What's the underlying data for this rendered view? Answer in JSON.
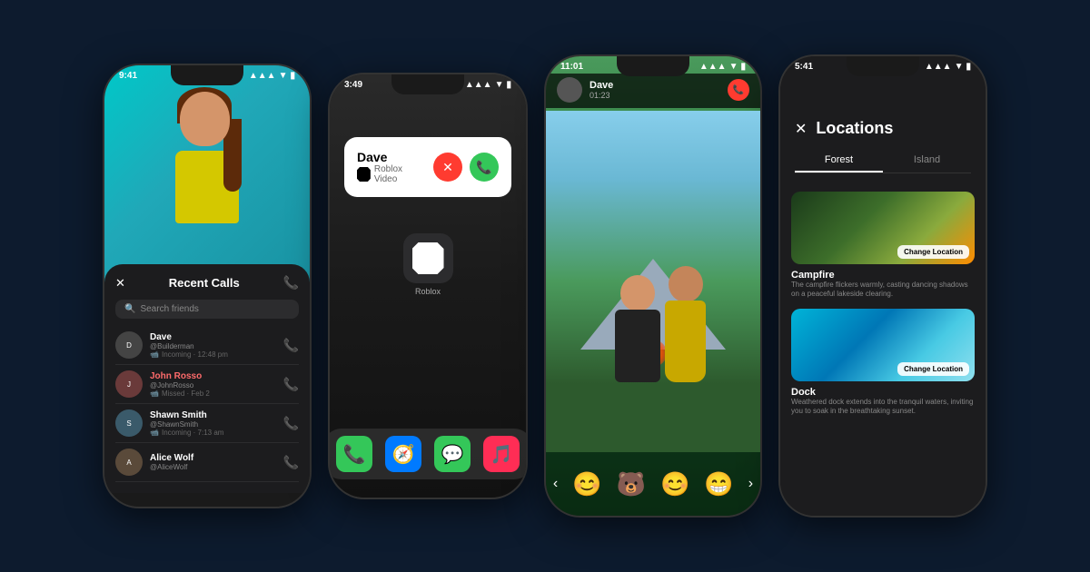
{
  "page": {
    "background": "#0d1b2e"
  },
  "phone1": {
    "status_time": "9:41",
    "panel_title": "Recent Calls",
    "search_placeholder": "Search friends",
    "calls": [
      {
        "name": "Dave",
        "username": "@Builderman",
        "meta": "Incoming · 12:48 pm",
        "missed": false,
        "color": "#888"
      },
      {
        "name": "John Rosso",
        "username": "@JohnRosso",
        "meta": "Missed · Feb 2",
        "missed": true,
        "color": "#c0392b"
      },
      {
        "name": "Shawn Smith",
        "username": "@ShawnSmith",
        "meta": "Incoming · 7:13 am",
        "missed": false,
        "color": "#888"
      },
      {
        "name": "Alice Wolf",
        "username": "@AliceWolf",
        "meta": "",
        "missed": false,
        "color": "#888"
      }
    ]
  },
  "phone2": {
    "status_time": "3:49",
    "caller_name": "Dave",
    "caller_app": "Roblox Video",
    "app_label": "Roblox",
    "dock": [
      "📞",
      "🧭",
      "💬",
      "🎵"
    ]
  },
  "phone3": {
    "status_time": "11:01",
    "caller_name": "Dave",
    "call_duration": "01:23",
    "emojis": [
      "😊",
      "🐻",
      "😊",
      "😁"
    ]
  },
  "phone4": {
    "status_time": "5:41",
    "title": "Locations",
    "close_label": "✕",
    "tabs": [
      {
        "label": "Forest",
        "active": true
      },
      {
        "label": "Island",
        "active": false
      }
    ],
    "locations": [
      {
        "name": "Campfire",
        "description": "The campfire flickers warmly, casting dancing shadows on a peaceful lakeside clearing.",
        "has_button": true,
        "button_label": "Change Location",
        "type": "campfire"
      },
      {
        "name": "Dock",
        "description": "Weathered dock extends into the tranquil waters, inviting you to soak in the breathtaking sunset.",
        "has_button": true,
        "button_label": "Change Location",
        "type": "dock"
      }
    ]
  }
}
